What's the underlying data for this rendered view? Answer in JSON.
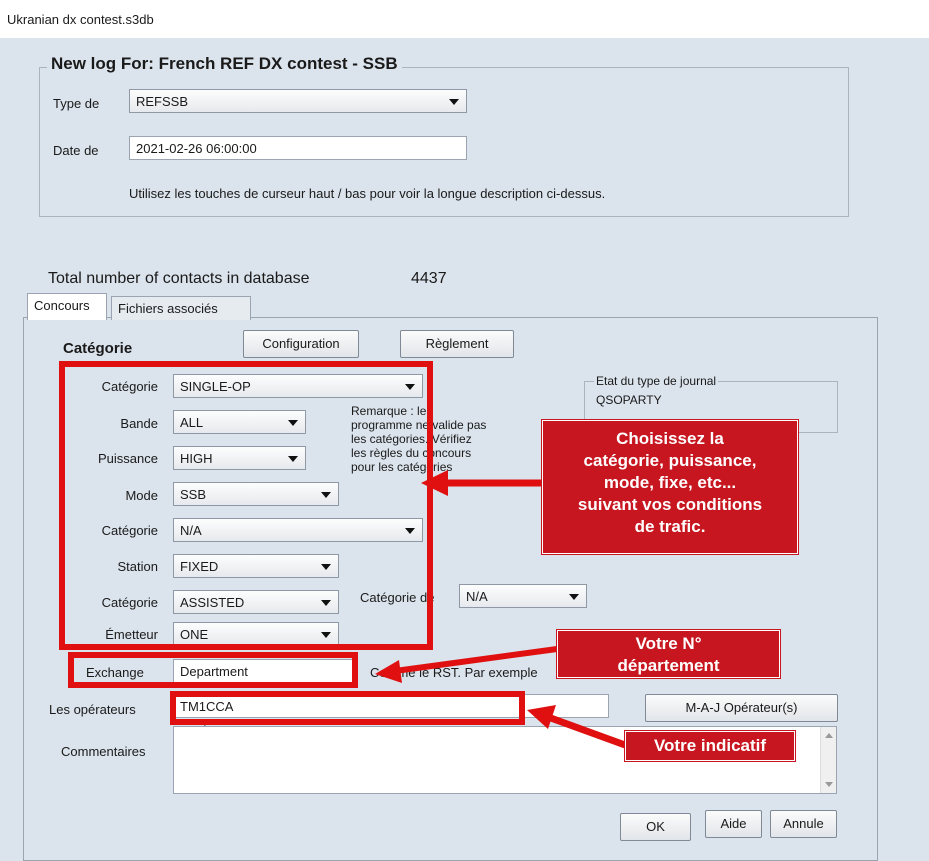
{
  "window": {
    "title": "Ukranian dx contest.s3db"
  },
  "newlog": {
    "legend": "New log For: French REF DX contest - SSB",
    "type_label": "Type de",
    "type_value": "REFSSB",
    "date_label": "Date de",
    "date_value": "2021-02-26 06:00:00",
    "hint": "Utilisez les touches de curseur haut / bas pour voir la longue description ci-dessus."
  },
  "totals": {
    "label": "Total number of contacts in database",
    "value": "4437"
  },
  "tabs": [
    {
      "label": "Concours"
    },
    {
      "label": "Fichiers associés"
    }
  ],
  "contest": {
    "section_title": "Catégorie",
    "configuration_button": "Configuration",
    "reglement_button": "Règlement",
    "fields": [
      {
        "label": "Catégorie",
        "value": "SINGLE-OP"
      },
      {
        "label": "Bande",
        "value": "ALL"
      },
      {
        "label": "Puissance",
        "value": "HIGH"
      },
      {
        "label": "Mode",
        "value": "SSB"
      },
      {
        "label": "Catégorie",
        "value": "N/A"
      },
      {
        "label": "Station",
        "value": "FIXED"
      },
      {
        "label": "Catégorie",
        "value": "ASSISTED"
      },
      {
        "label": "Émetteur",
        "value": "ONE"
      }
    ],
    "categorie_de_label": "Catégorie de",
    "categorie_de_value": "N/A",
    "remark": [
      "Remarque : le",
      "programme ne valide pas",
      "les catégories. Vérifiez",
      "les règles du concours",
      "pour les catégories"
    ],
    "etat_legend": "Etat du type de journal",
    "etat_value": "QSOPARTY",
    "exchange_label": "Exchange",
    "exchange_value": "Department",
    "exchange_hint": "Comme le RST. Par exemple",
    "operateurs_label": "Les opérateurs",
    "operateurs_value": "TM1CCA",
    "maj_button": "M-A-J Opérateur(s)",
    "commentaires_label": "Commentaires",
    "ok_button": "OK",
    "aide_button": "Aide",
    "annule_button": "Annule"
  },
  "annotations": {
    "callout1": [
      "Choisissez la",
      "catégorie, puissance,",
      "mode, fixe, etc...",
      "suivant vos conditions",
      "de trafic."
    ],
    "callout2": [
      "Votre N°",
      "département"
    ],
    "callout3": "Votre indicatif",
    "color": "#e01010"
  }
}
